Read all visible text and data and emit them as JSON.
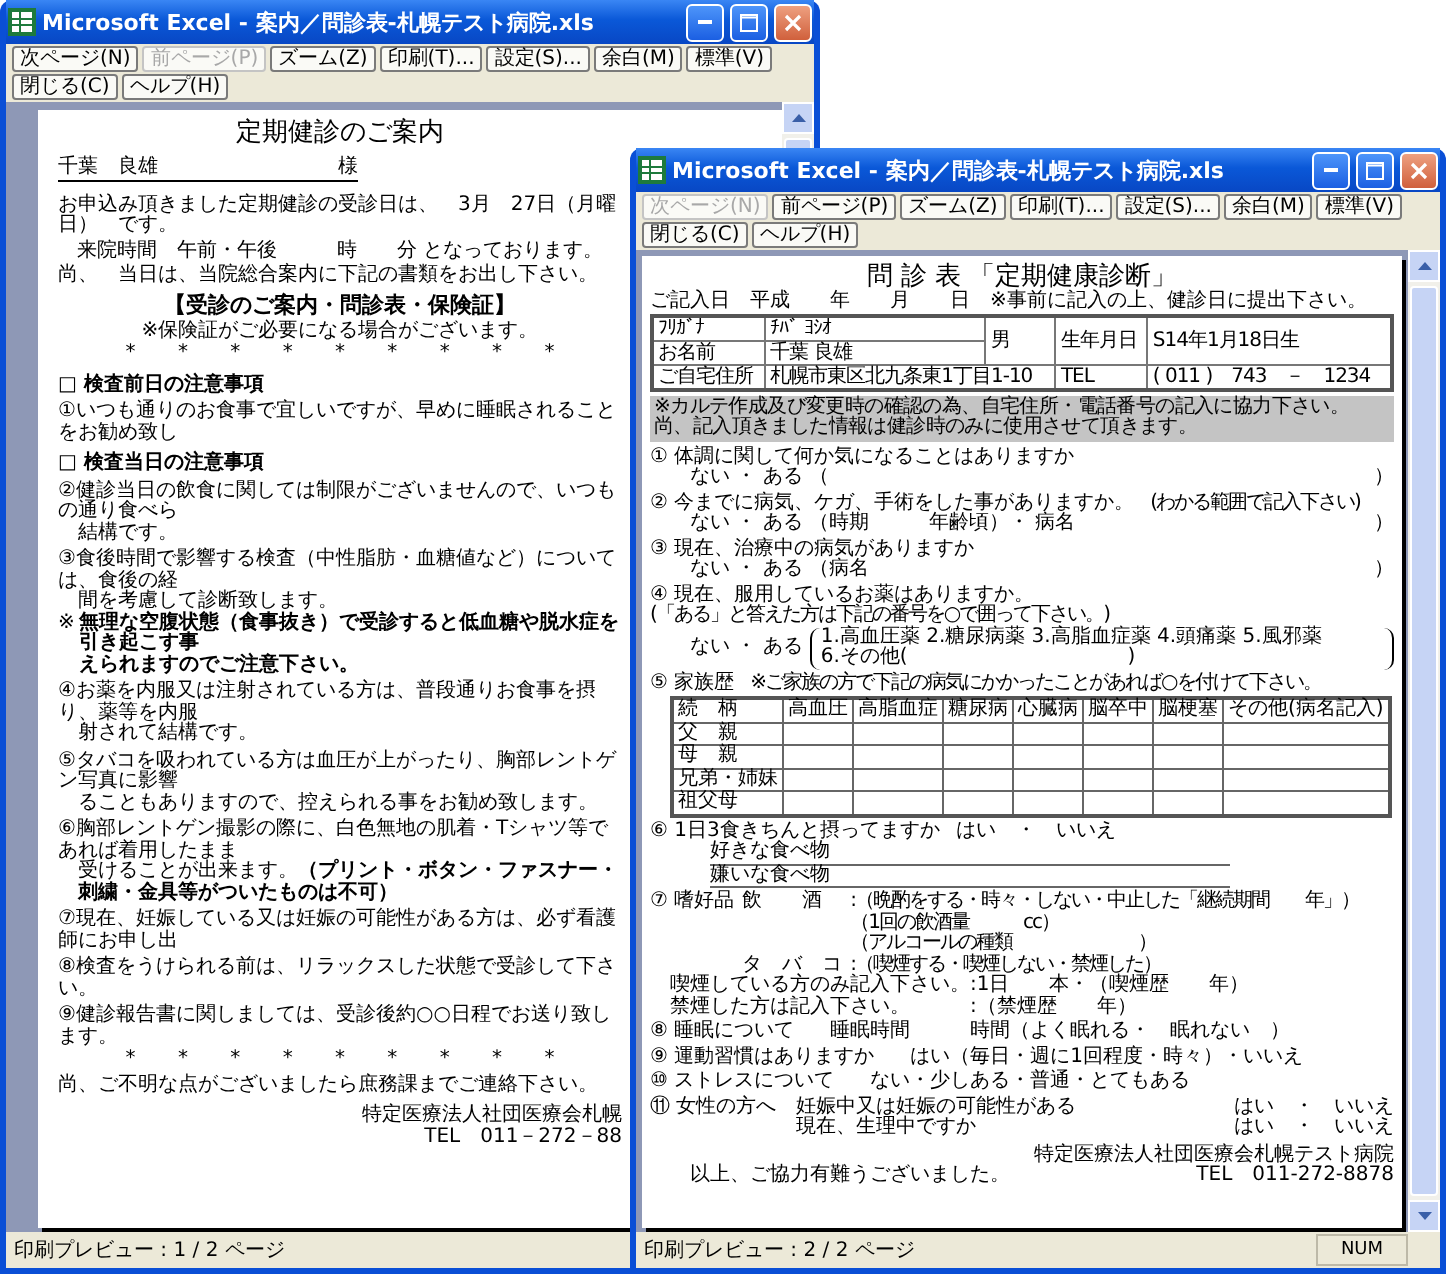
{
  "windows": [
    {
      "kind": "guide",
      "title": "Microsoft Excel - 案内／問診表-札幌テスト病院.xls",
      "toolbar": [
        {
          "label": "次ページ(N)",
          "disabled": false
        },
        {
          "label": "前ページ(P)",
          "disabled": true
        },
        {
          "label": "ズーム(Z)",
          "disabled": false
        },
        {
          "label": "印刷(T)...",
          "disabled": false
        },
        {
          "label": "設定(S)...",
          "disabled": false
        },
        {
          "label": "余白(M)",
          "disabled": false
        },
        {
          "label": "標準(V)",
          "disabled": false
        },
        {
          "label": "閉じる(C)",
          "disabled": false
        },
        {
          "label": "ヘルプ(H)",
          "disabled": false
        }
      ],
      "page": {
        "blocks": [
          {
            "kind": "title",
            "text": "定期健診のご案内"
          },
          {
            "kind": "addressee",
            "name": "千葉　良雄",
            "honorific": "様"
          },
          {
            "kind": "para",
            "text": "お申込み頂きました定期健診の受診日は、　3月　27日（月曜日）　です。"
          },
          {
            "kind": "para-center",
            "text": "来院時間　午前・午後　　　時　　分 となっております。"
          },
          {
            "kind": "para",
            "text": "尚、　当日は、当院総合案内に下記の書類をお出し下さい。"
          },
          {
            "kind": "heading-center",
            "text": "【受診のご案内・問診表・保険証】"
          },
          {
            "kind": "note-center",
            "text": "※保険証がご必要になる場合がございます。"
          },
          {
            "kind": "stars",
            "text": "* * * * * * * * *"
          },
          {
            "kind": "section",
            "text": "□ 検査前日の注意事項"
          },
          {
            "kind": "item",
            "lines": [
              "①いつも通りのお食事で宜しいですが、早めに睡眠されることをお勧め致し"
            ]
          },
          {
            "kind": "section",
            "text": "□ 検査当日の注意事項"
          },
          {
            "kind": "item",
            "lines": [
              "②健診当日の飲食に関しては制限がございませんので、いつもの通り食べら",
              "結構です。"
            ]
          },
          {
            "kind": "item",
            "lines": [
              "③食後時間で影響する検査（中性脂肪・血糖値など）については、食後の経",
              "間を考慮して診断致します。"
            ]
          },
          {
            "kind": "warning",
            "mark": "※",
            "lines": [
              "無理な空腹状態（食事抜き）で受診すると低血糖や脱水症を引き起こす事",
              "えられますのでご注意下さい。"
            ]
          },
          {
            "kind": "item",
            "lines": [
              "④お薬を内服又は注射されている方は、普段通りお食事を摂り、薬等を内服",
              "射されて結構です。"
            ]
          },
          {
            "kind": "item",
            "lines": [
              "⑤タバコを吸われている方は血圧が上がったり、胸部レントゲン写真に影響",
              "ることもありますので、控えられる事をお勧め致します。"
            ]
          },
          {
            "kind": "item",
            "lines": [
              "⑥胸部レントゲン撮影の際に、白色無地の肌着・Tシャツ等であれば着用したまま",
              "受けることが出来ます。**（プリント・ボタン・ファスナー・刺繍・金具等がついたものは不可）**"
            ]
          },
          {
            "kind": "item",
            "lines": [
              "⑦現在、妊娠している又は妊娠の可能性がある方は、必ず看護師にお申し出"
            ]
          },
          {
            "kind": "item",
            "lines": [
              "⑧検査をうけられる前は、リラックスした状態で受診して下さい。"
            ]
          },
          {
            "kind": "item",
            "lines": [
              "⑨健診報告書に関しましては、受診後約○○日程でお送り致します。"
            ]
          },
          {
            "kind": "stars",
            "text": "* * * * * * * * *"
          },
          {
            "kind": "para",
            "text": "尚、ご不明な点がございましたら庶務課までご連絡下さい。"
          },
          {
            "kind": "signature",
            "lines": [
              "特定医療法人社団医療会札幌",
              "TEL　011－272－88"
            ]
          }
        ]
      },
      "status": {
        "text": "印刷プレビュー : 1 / 2 ページ"
      }
    },
    {
      "kind": "questionnaire",
      "title": "Microsoft Excel - 案内／問診表-札幌テスト病院.xls",
      "toolbar": [
        {
          "label": "次ページ(N)",
          "disabled": true
        },
        {
          "label": "前ページ(P)",
          "disabled": false
        },
        {
          "label": "ズーム(Z)",
          "disabled": false
        },
        {
          "label": "印刷(T)...",
          "disabled": false
        },
        {
          "label": "設定(S)...",
          "disabled": false
        },
        {
          "label": "余白(M)",
          "disabled": false
        },
        {
          "label": "標準(V)",
          "disabled": false
        },
        {
          "label": "閉じる(C)",
          "disabled": false
        },
        {
          "label": "ヘルプ(H)",
          "disabled": false
        }
      ],
      "page": {
        "title": "問 診 表 「定期健康診断」",
        "date_line": "ご記入日　平成　　年　　月　　日　※事前に記入の上、健診日に提出下さい。",
        "profile": {
          "furigana_label": "ﾌﾘｶﾞﾅ",
          "furigana": "ﾁﾊﾞ ﾖｼｵ",
          "name_label": "お名前",
          "name": "千葉 良雄",
          "sex": "男",
          "birth_label": "生年月日",
          "birth": "S14年1月18日生",
          "address_label": "ご自宅住所",
          "address": "札幌市東区北九条東1丁目1-10",
          "tel_label": "TEL",
          "tel": "( 011 )　743　－　1234"
        },
        "notice": [
          "※カルテ作成及び変更時の確認の為、自宅住所・電話番号の記入に協力下さい。",
          "尚、記入頂きました情報は健診時のみに使用させて頂きます。"
        ],
        "questions": [
          {
            "kind": "bracket",
            "question": "① 体調に関して何か気になることはありますか",
            "answer": "ない ・ ある （",
            "close": "）"
          },
          {
            "kind": "bracket",
            "question": "② 今までに病気、ケガ、手術をした事がありますか。",
            "note": "(わかる範囲で記入下さい)",
            "answer": "ない ・ ある （時期　　　年齢頃）・ 病名",
            "close": "）"
          },
          {
            "kind": "bracket",
            "question": "③ 現在、治療中の病気がありますか",
            "answer": "ない ・ ある （病名",
            "close": "）"
          },
          {
            "kind": "medicine",
            "question": "④ 現在、服用しているお薬はありますか。",
            "note": "(「ある」と答えた方は下記の番号を○で囲って下さい。)",
            "answer": "ない ・ ある",
            "options": [
              "1.高血圧薬 2.糖尿病薬 3.高脂血症薬 4.頭痛薬 5.風邪薬",
              "6.その他(　　　　　　　　　　　)"
            ]
          },
          {
            "kind": "family",
            "question": "⑤ 家族歴",
            "note": "※ご家族の方で下記の病気にかかったことがあれば○を付けて下さい。",
            "columns": [
              "続　柄",
              "高血圧",
              "高脂血症",
              "糖尿病",
              "心臓病",
              "脳卒中",
              "脳梗塞",
              "その他(病名記入)"
            ],
            "rows": [
              "父　親",
              "母　親",
              "兄弟・姉妹",
              "祖父母"
            ]
          },
          {
            "kind": "meals",
            "question": "⑥ 1日3食きちんと摂ってますか",
            "answer": "はい　・　いいえ",
            "lines": [
              "好きな食べ物",
              "嫌いな食べ物"
            ]
          },
          {
            "kind": "habits",
            "question": "⑦ 嗜好品",
            "rows": [
              {
                "label": "飲　　酒",
                "lines": [
                  ":（晩酌をする・時々・しない・中止した「継続期間　　年」）",
                  "（1回の飲酒量　　　cc）",
                  "（アルコールの種類　　　　　　　）"
                ]
              },
              {
                "label": "タ　バ　コ",
                "lines": [
                  ":（喫煙する・喫煙しない・禁煙した）"
                ]
              }
            ],
            "extra": [
              {
                "label": "喫煙している方のみ記入下さい。",
                "value": ":1日　　本・（喫煙歴　　年）"
              },
              {
                "label": "禁煙した方は記入下さい。",
                "value": ":（禁煙歴　　年）"
              }
            ]
          },
          {
            "kind": "line",
            "parts": [
              "⑧ 睡眠について",
              "睡眠時間　　　時間（よく眠れる・　眠れない　）"
            ]
          },
          {
            "kind": "line",
            "parts": [
              "⑨ 運動習慣はありますか",
              "はい（毎日・週に1回程度・時々）・いいえ"
            ]
          },
          {
            "kind": "line",
            "parts": [
              "⑩ ストレスについて",
              "ない・少しある・普通・とてもある"
            ]
          },
          {
            "kind": "women",
            "question": "⑪ 女性の方へ",
            "rows": [
              {
                "q": "妊娠中又は妊娠の可能性がある",
                "a": "はい　・　いいえ"
              },
              {
                "q": "現在、生理中ですか",
                "a": "はい　・　いいえ"
              }
            ]
          }
        ],
        "closing": "以上、ご協力有難うございました。",
        "signature": [
          "特定医療法人社団医療会札幌テスト病院",
          "TEL　011-272-8878"
        ]
      },
      "status": {
        "text": "印刷プレビュー : 2 / 2 ページ",
        "indicators": [
          "NUM"
        ]
      }
    }
  ]
}
